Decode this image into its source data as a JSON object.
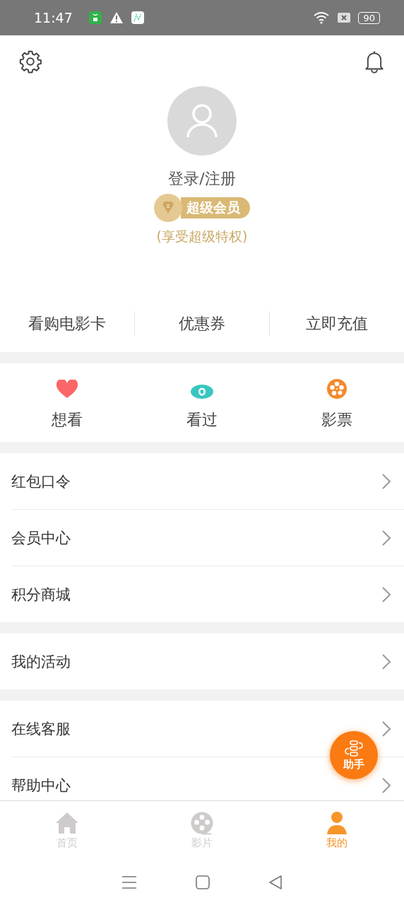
{
  "status_bar": {
    "time": "11:47",
    "battery": "90"
  },
  "profile": {
    "login": "登录/注册",
    "member_badge": "超级会员",
    "member_note": "(享受超级特权)"
  },
  "quick_links": [
    "看购电影卡",
    "优惠券",
    "立即充值"
  ],
  "shortcuts": [
    {
      "kind": "heart",
      "label": "想看"
    },
    {
      "kind": "eye",
      "label": "看过"
    },
    {
      "kind": "reel",
      "label": "影票"
    }
  ],
  "menu_groups": [
    [
      "红包口令",
      "会员中心",
      "积分商城"
    ],
    [
      "我的活动"
    ],
    [
      "在线客服",
      "帮助中心"
    ]
  ],
  "assistant": {
    "label": "助手"
  },
  "tabs": [
    {
      "kind": "home",
      "label": "首页",
      "selected": false
    },
    {
      "kind": "reel",
      "label": "影片",
      "selected": false
    },
    {
      "kind": "person",
      "label": "我的",
      "selected": true
    }
  ]
}
